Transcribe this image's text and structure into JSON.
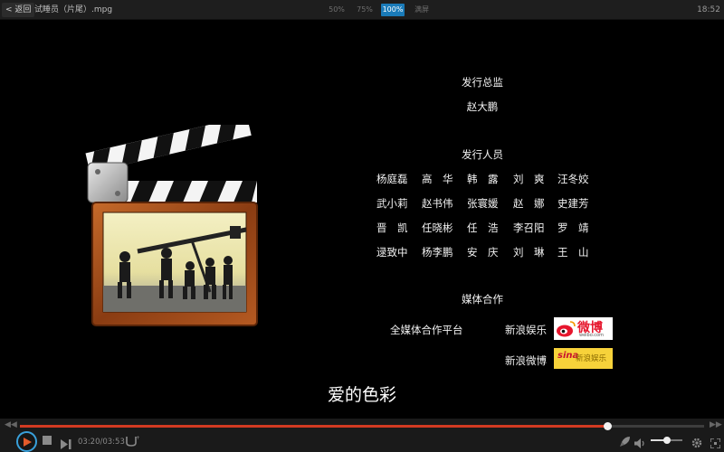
{
  "topbar": {
    "back_label": "< 返回",
    "file_title": "试睡员（片尾）.mpg",
    "zoom_options": [
      "50%",
      "75%",
      "100%",
      "满屏"
    ],
    "active_zoom": "100%",
    "clock": "18:52"
  },
  "credits": {
    "section1_title": "发行总监",
    "section1_name": "赵大鹏",
    "section2_title": "发行人员",
    "staff_rows": [
      [
        "杨庭磊",
        "高　华",
        "韩　露",
        "刘　爽",
        "汪冬姣"
      ],
      [
        "武小莉",
        "赵书伟",
        "张寰媛",
        "赵　娜",
        "史建芳"
      ],
      [
        "晋　凯",
        "任晓彬",
        "任　浩",
        "李召阳",
        "罗　靖"
      ],
      [
        "逯致中",
        "杨李鹏",
        "安　庆",
        "刘　琳",
        "王　山"
      ]
    ],
    "section3_title": "媒体合作",
    "media_partner_label": "全媒体合作平台",
    "partner1_label": "新浪娱乐",
    "partner2_label": "新浪微博",
    "weibo_logo_text": "微博",
    "weibo_logo_sub": "weibo.com",
    "sina_logo_mark": "sina",
    "sina_logo_text": "新浪娱乐"
  },
  "subtitle": "爱的色彩",
  "player": {
    "current_time": "03:20",
    "total_time": "03:53",
    "time_display": "03:20/03:53",
    "progress": 0.858,
    "volume": 0.5,
    "accent_color": "#39a0db",
    "progress_color": "#d23a22"
  },
  "icons": {
    "play": "play-icon",
    "stop": "stop-icon",
    "next": "next-icon",
    "subtitle": "subtitle-icon",
    "rocket": "rocket-icon",
    "volume": "volume-icon",
    "settings": "gear-icon",
    "fullscreen": "fullscreen-icon",
    "rewind": "rewind-icon",
    "forward": "forward-icon"
  }
}
